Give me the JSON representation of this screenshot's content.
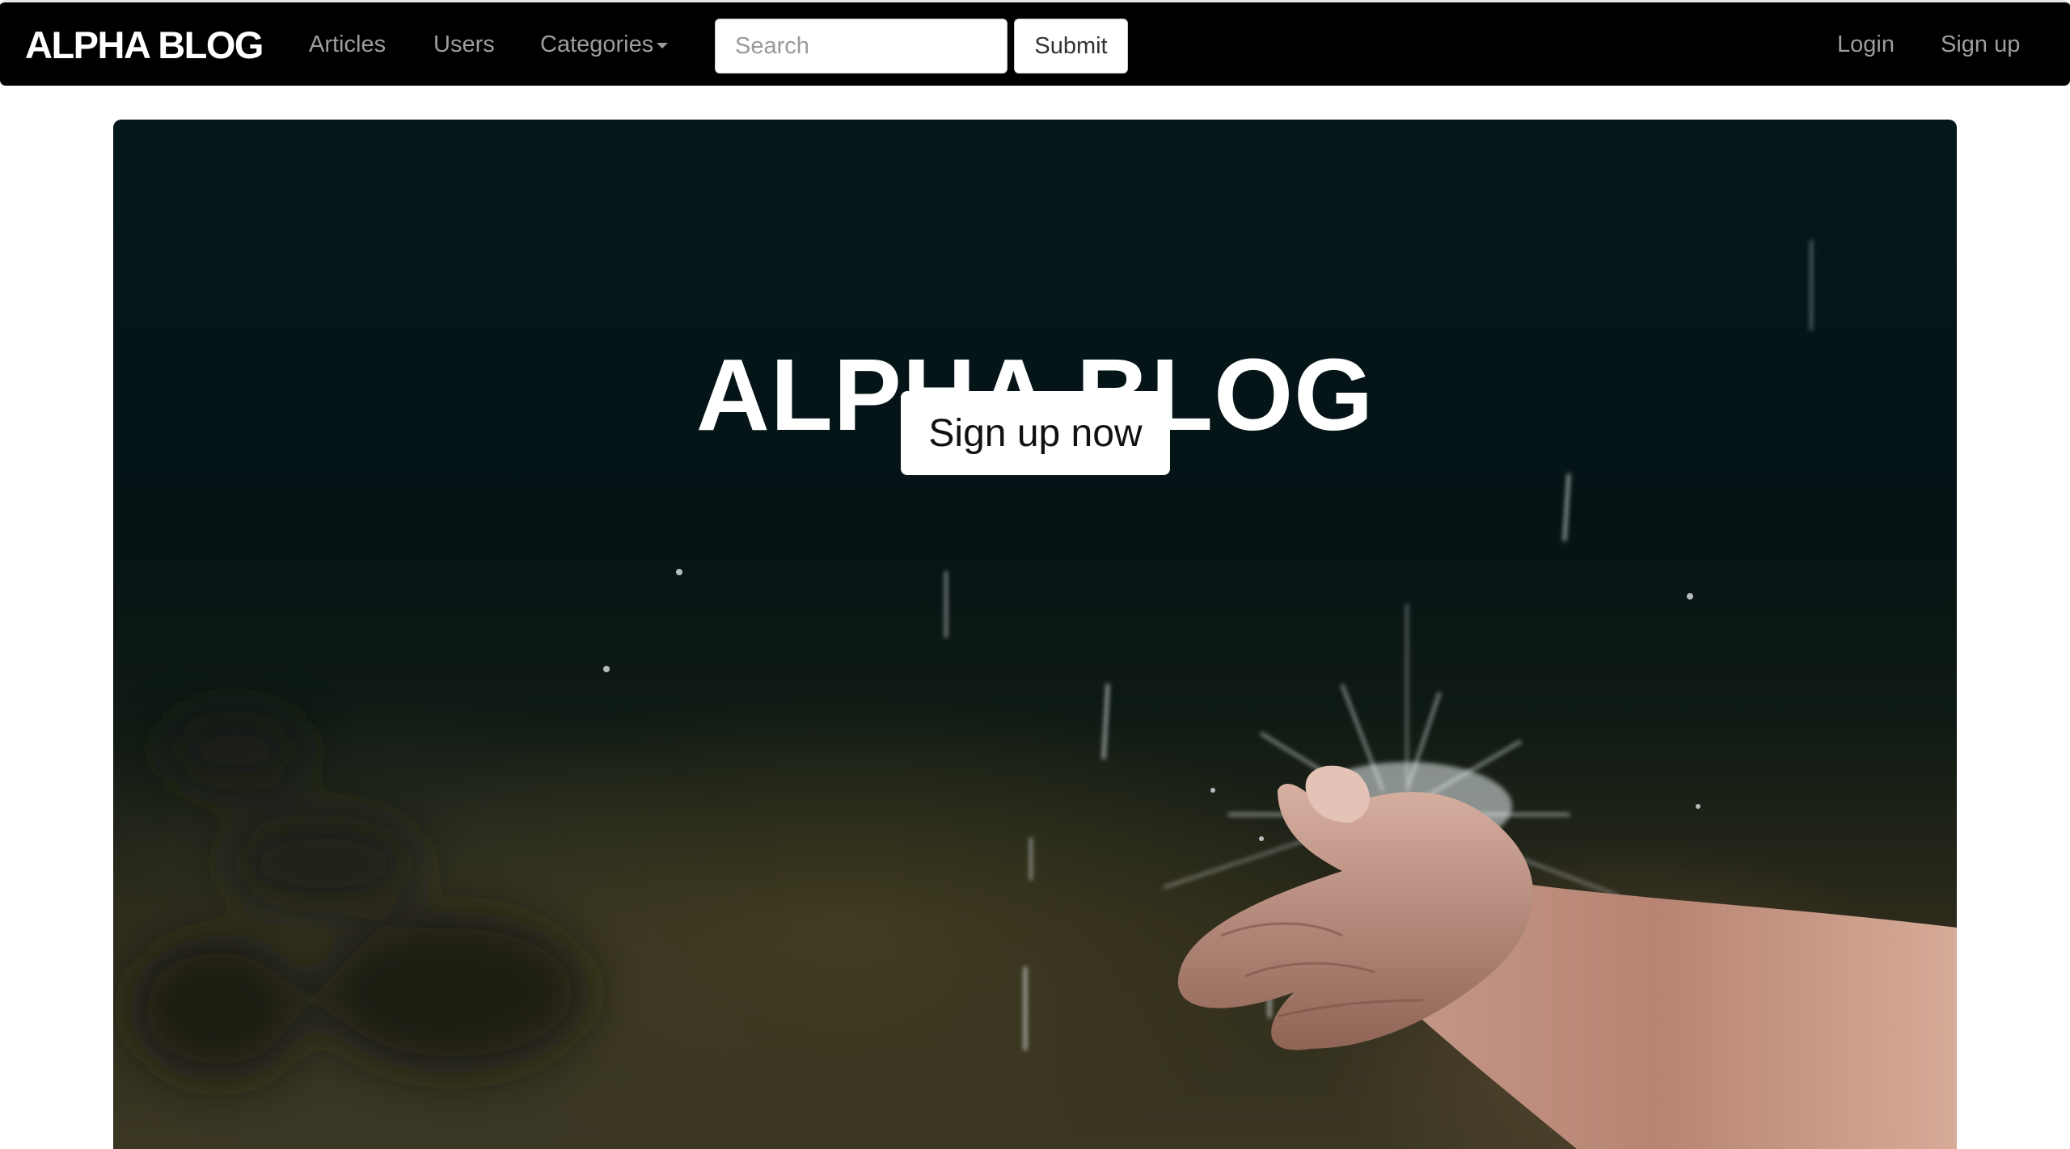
{
  "navbar": {
    "brand": "ALPHA BLOG",
    "links": {
      "articles": "Articles",
      "users": "Users",
      "categories": "Categories"
    },
    "search": {
      "placeholder": "Search",
      "value": ""
    },
    "submit_label": "Submit",
    "login": "Login",
    "signup": "Sign up"
  },
  "hero": {
    "title": "ALPHA BLOG",
    "cta_label": "Sign up now"
  },
  "colors": {
    "navbar_bg": "#000000",
    "nav_link": "#9d9d9d",
    "brand": "#ffffff",
    "hero_bg": "#04181b"
  }
}
